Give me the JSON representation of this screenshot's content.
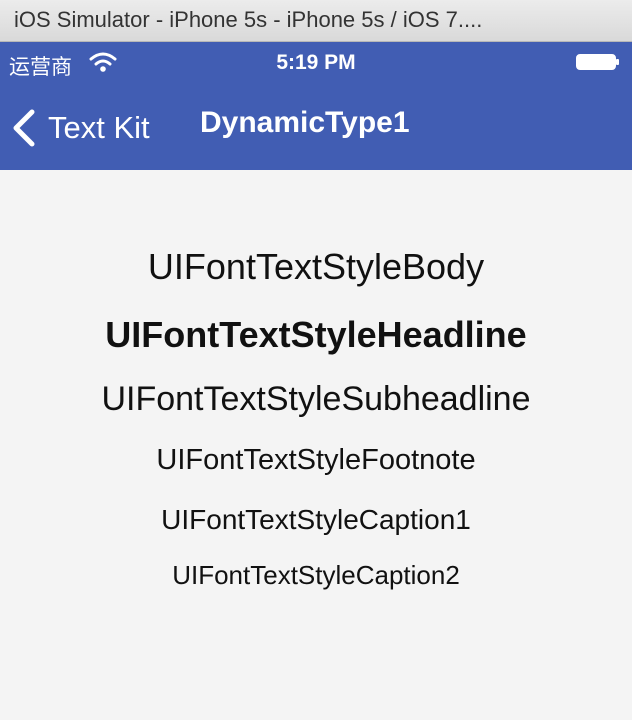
{
  "window": {
    "title": "iOS Simulator - iPhone 5s - iPhone 5s / iOS 7...."
  },
  "status_bar": {
    "carrier": "运营商",
    "time": "5:19 PM",
    "icons": [
      "wifi-icon",
      "battery-icon"
    ]
  },
  "navigation_bar": {
    "back_label": "Text Kit",
    "title": "DynamicType1",
    "color": "#415db3"
  },
  "text_styles": [
    {
      "label": "UIFontTextStyleBody"
    },
    {
      "label": "UIFontTextStyleHeadline"
    },
    {
      "label": "UIFontTextStyleSubheadline"
    },
    {
      "label": "UIFontTextStyleFootnote"
    },
    {
      "label": "UIFontTextStyleCaption1"
    },
    {
      "label": "UIFontTextStyleCaption2"
    }
  ]
}
